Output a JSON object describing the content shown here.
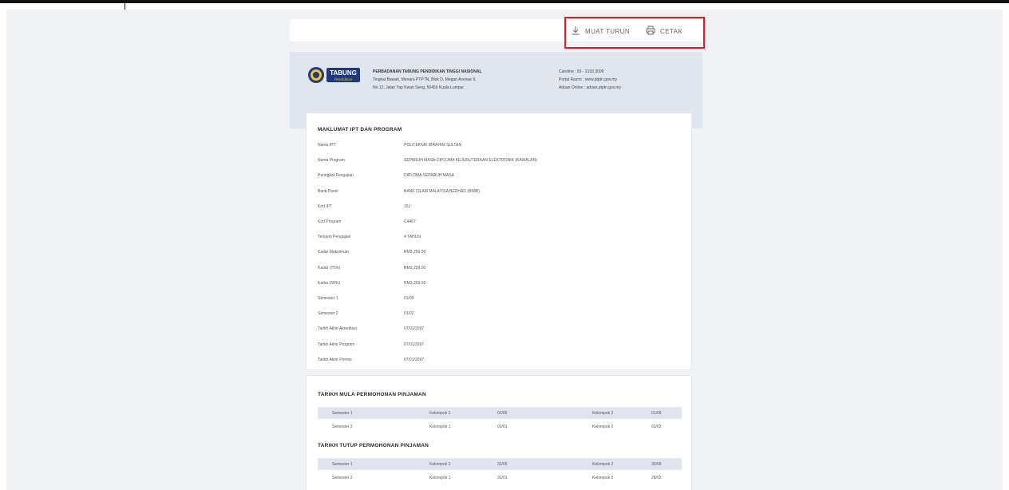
{
  "toolbar": {
    "download_label": "MUAT TURUN",
    "print_label": "CETAK",
    "download_icon": "download-icon",
    "print_icon": "printer-icon"
  },
  "header": {
    "logo_text": "TABUNG",
    "logo_subtext": "Pendidikan",
    "org_name": "PERBADANAN TABUNG PENDIDIKAN TINGGI NASIONAL",
    "address_1": "Tingkat Bawah, Menara PTPTN, Blok D, Megan Avenue II,",
    "address_2": "No.12, Jalan Yap Kwan Seng, 50450 Kuala Lumpur",
    "careline": "Careline : 03 - 2193 3000",
    "portal": "Portal Rasmi : www.ptptn.gov.my",
    "aduan": "Aduan Online : aduan.ptptn.gov.my"
  },
  "program": {
    "title": "MAKLUMAT IPT DAN PROGRAM",
    "rows": [
      {
        "label": "Nama IPT",
        "value": "POLITEKNIK IBRAHIM SULTAN"
      },
      {
        "label": "Nama Program",
        "value": "SEPARUH MASA-DIPLOMA KEJURUTERAAN ELEKTRONIK (KAWALAN)"
      },
      {
        "label": "Peringkat Pengajian",
        "value": "DIPLOMA SEPARUH MASA"
      },
      {
        "label": "Bank Panel",
        "value": "BANK ISLAM MALAYSIA BERHAD (BIMB)"
      },
      {
        "label": "Kod IPT",
        "value": "15J"
      },
      {
        "label": "Kod Program",
        "value": "C4467"
      },
      {
        "label": "Tempoh Pengajian",
        "value": "4 TAHUN"
      },
      {
        "label": "Kadar Maksimum",
        "value": "RM3,259.00"
      },
      {
        "label": "Kadar (75%)",
        "value": "RM3,259.00"
      },
      {
        "label": "Kadar (50%)",
        "value": "RM3,259.00"
      },
      {
        "label": "Semester 1",
        "value": "01/09"
      },
      {
        "label": "Semester 2",
        "value": "01/02"
      },
      {
        "label": "Tarikh Akhir Akreditasi",
        "value": "07/01/2097"
      },
      {
        "label": "Tarikh Akhir Program",
        "value": "07/01/2097"
      },
      {
        "label": "Tarikh Akhir Premis",
        "value": "07/01/2097"
      }
    ]
  },
  "mula": {
    "title": "TARIKH MULA PERMOHONAN PINJAMAN",
    "rows": [
      {
        "semester": "Semester 1",
        "g1": "Kelompok 1",
        "d1": "01/06",
        "g2": "Kelompok 2",
        "d2": "01/09"
      },
      {
        "semester": "Semester 2",
        "g1": "Kelompok 1",
        "d1": "01/01",
        "g2": "Kelompok 2",
        "d2": "01/02"
      }
    ]
  },
  "tutup": {
    "title": "TARIKH TUTUP PERMOHONAN PINJAMAN",
    "rows": [
      {
        "semester": "Semester 1",
        "g1": "Kelompok 1",
        "d1": "31/06",
        "g2": "Kelompok 2",
        "d2": "30/09"
      },
      {
        "semester": "Semester 2",
        "g1": "Kelompok 1",
        "d1": "31/01",
        "g2": "Kelompok 2",
        "d2": "28/02"
      }
    ]
  }
}
